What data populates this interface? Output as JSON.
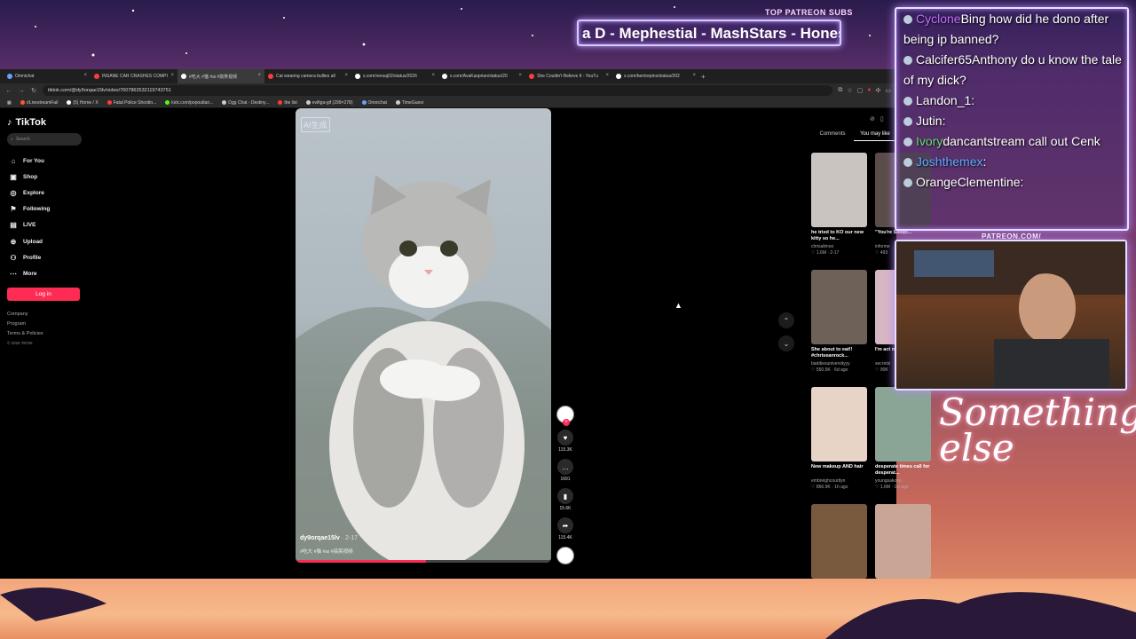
{
  "overlay": {
    "top_patreon_label": "TOP PATREON SUBS",
    "ticker_text": "a D - Mephestial - MashStars - Honest",
    "patreon_url_label": "PATREON.COM/",
    "brand_text": "Something else"
  },
  "chat": {
    "messages": [
      {
        "user": "Cyclone",
        "user_color": "#c46bff",
        "text": "Bing how did he dono after being ip banned?"
      },
      {
        "user": "Calcifer65",
        "user_color": "#ffffff",
        "text": "Anthony do u know the tale of my dick?"
      },
      {
        "user": "Landon_1",
        "user_color": "#ffffff",
        "text": ":"
      },
      {
        "user": "Jutin",
        "user_color": "#ffffff",
        "text": ":"
      },
      {
        "user": "Ivory",
        "user_color": "#5ee06a",
        "text": "dancantstream call out Cenk"
      },
      {
        "user": "Joshthemex",
        "user_color": "#5aa9ff",
        "text": ":"
      },
      {
        "user": "OrangeClementine",
        "user_color": "#ffffff",
        "text": ":"
      }
    ]
  },
  "browser": {
    "tabs": [
      {
        "label": "Omnichat",
        "color": "#6aa0ff"
      },
      {
        "label": "INSANE CAR CRASHES COMPI",
        "color": "#ff3b3b"
      },
      {
        "label": "#吃大 #猫 #ai #搞笑视频",
        "color": "#ffffff"
      },
      {
        "label": "Cat wearing camera bullies all",
        "color": "#ff3b3b"
      },
      {
        "label": "x.com/versaj02/status/2026",
        "color": "#ffffff"
      },
      {
        "label": "x.com/AvaKasprian/status/20",
        "color": "#ffffff"
      },
      {
        "label": "She Couldn't Believe It - YouTu",
        "color": "#ff3b3b"
      },
      {
        "label": "x.com/bentrepino/status/202",
        "color": "#ffffff"
      }
    ],
    "url": "tiktok.com/@dy9orqae15lv/video/7607862532119743751",
    "bookmarks": [
      {
        "label": "r/LivestreamFail",
        "color": "#ff5a1f"
      },
      {
        "label": "(5) Home / X",
        "color": "#ffffff"
      },
      {
        "label": "Fatal Police Shootin...",
        "color": "#ff3b3b"
      },
      {
        "label": "kick.com/popoutlan...",
        "color": "#53fc18"
      },
      {
        "label": "Dgg Chat - Destiny...",
        "color": "#cccccc"
      },
      {
        "label": "the list",
        "color": "#ff3b3b"
      },
      {
        "label": "evifiga-gif (299×278)",
        "color": "#cccccc"
      },
      {
        "label": "Omnichat",
        "color": "#6aa0ff"
      },
      {
        "label": "TimeGuesr",
        "color": "#cccccc"
      }
    ]
  },
  "tiktok": {
    "logo_text": "TikTok",
    "search_placeholder": "Search",
    "nav": [
      {
        "label": "For You",
        "icon": "home-icon",
        "glyph": "⌂"
      },
      {
        "label": "Shop",
        "icon": "shop-icon",
        "glyph": "▣"
      },
      {
        "label": "Explore",
        "icon": "compass-icon",
        "glyph": "◎"
      },
      {
        "label": "Following",
        "icon": "following-icon",
        "glyph": "⚑"
      },
      {
        "label": "LIVE",
        "icon": "live-icon",
        "glyph": "▤"
      },
      {
        "label": "Upload",
        "icon": "upload-icon",
        "glyph": "⊕"
      },
      {
        "label": "Profile",
        "icon": "profile-icon",
        "glyph": "⚇"
      },
      {
        "label": "More",
        "icon": "more-icon",
        "glyph": "⋯"
      }
    ],
    "login_label": "Log in",
    "footer": [
      "Company",
      "Program",
      "Terms & Policies"
    ],
    "copyright": "© 2026 TikTok",
    "video": {
      "ai_badge": "AI生成",
      "author": "dy9orqae15lv",
      "date": "· 2-17",
      "tags": "#吃大 #猫 #ai #搞笑视频",
      "progress": 0.51
    },
    "actions": [
      {
        "name": "like",
        "icon": "heart-icon",
        "glyph": "♥",
        "count": "115.3K"
      },
      {
        "name": "comment",
        "icon": "comment-icon",
        "glyph": "…",
        "count": "1691"
      },
      {
        "name": "bookmark",
        "icon": "bookmark-icon",
        "glyph": "▮",
        "count": "15.6K"
      },
      {
        "name": "share",
        "icon": "share-icon",
        "glyph": "➦",
        "count": "115.4K"
      }
    ],
    "right_tabs": [
      "Comments",
      "You may like"
    ],
    "cards": [
      {
        "caption": "he tried to KO our new kitty so he...",
        "user": "chrisalimoo",
        "meta": "♡ 1.6M · 2-17",
        "color": "#c9c4bf"
      },
      {
        "caption": "\"You're Sleepi...",
        "user": "informe",
        "meta": "♡ 493",
        "color": "#5a4d49"
      },
      {
        "caption": "She about to eat!! #chriseanrock...",
        "user": "baddiesuniversityyy",
        "meta": "♡ 550.5K · 6d ago",
        "color": "#6e6258"
      },
      {
        "caption": "I'm act mad. ...",
        "user": "secretsi",
        "meta": "♡ 90K",
        "color": "#d7b6c3"
      },
      {
        "caption": "New makeup AND hair",
        "user": "embreighcourtlyn",
        "meta": "♡ 866.9K · 1h ago",
        "color": "#e7d4c6"
      },
      {
        "caption": "desperate times call for desperat...",
        "user": "youngsakooo",
        "meta": "♡ 1.6M · 1w ago",
        "color": "#8aa596"
      },
      {
        "caption": "",
        "user": "",
        "meta": "",
        "color": "#7a5a3e"
      },
      {
        "caption": "",
        "user": "",
        "meta": "",
        "color": "#c9a596"
      }
    ]
  }
}
